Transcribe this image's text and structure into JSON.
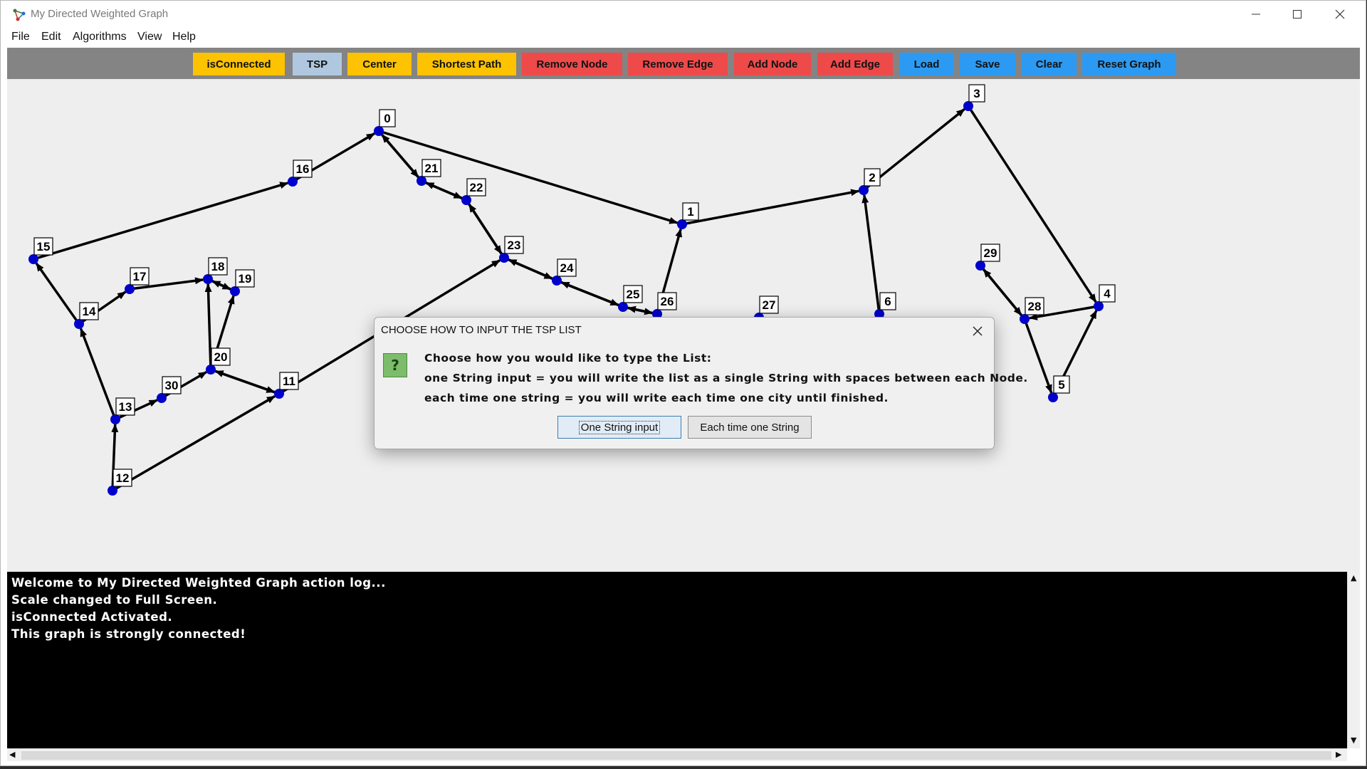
{
  "window": {
    "title": "My Directed Weighted Graph"
  },
  "menu": [
    "File",
    "Edit",
    "Algorithms",
    "View",
    "Help"
  ],
  "toolbar": {
    "buttons": [
      {
        "label": "isConnected",
        "color": "#fdc200"
      },
      {
        "label": "TSP",
        "color": "#afc8df"
      },
      {
        "label": "Center",
        "color": "#fdc200"
      },
      {
        "label": "Shortest Path",
        "color": "#fdc200"
      },
      {
        "label": "Remove Node",
        "color": "#ee4a4a"
      },
      {
        "label": "Remove Edge",
        "color": "#ee4a4a"
      },
      {
        "label": "Add Node",
        "color": "#ee4a4a"
      },
      {
        "label": "Add Edge",
        "color": "#ee4a4a"
      },
      {
        "label": "Load",
        "color": "#2c9af2"
      },
      {
        "label": "Save",
        "color": "#2c9af2"
      },
      {
        "label": "Clear",
        "color": "#2c9af2"
      },
      {
        "label": "Reset Graph",
        "color": "#2c9af2"
      }
    ]
  },
  "graph": {
    "node_color": "#0000cc",
    "edge_color": "#000000",
    "nodes": [
      "0",
      "1",
      "2",
      "3",
      "4",
      "5",
      "6",
      "11",
      "12",
      "13",
      "14",
      "15",
      "16",
      "17",
      "18",
      "19",
      "20",
      "21",
      "22",
      "23",
      "24",
      "25",
      "26",
      "27",
      "28",
      "29",
      "30"
    ],
    "edges": [
      [
        "15",
        "16"
      ],
      [
        "16",
        "0"
      ],
      [
        "0",
        "21"
      ],
      [
        "21",
        "0"
      ],
      [
        "22",
        "21"
      ],
      [
        "21",
        "22"
      ],
      [
        "23",
        "22"
      ],
      [
        "22",
        "23"
      ],
      [
        "23",
        "24"
      ],
      [
        "24",
        "23"
      ],
      [
        "24",
        "25"
      ],
      [
        "25",
        "24"
      ],
      [
        "25",
        "26"
      ],
      [
        "26",
        "25"
      ],
      [
        "26",
        "1"
      ],
      [
        "0",
        "1"
      ],
      [
        "1",
        "2"
      ],
      [
        "6",
        "2"
      ],
      [
        "2",
        "3"
      ],
      [
        "3",
        "4"
      ],
      [
        "5",
        "4"
      ],
      [
        "4",
        "28"
      ],
      [
        "28",
        "5"
      ],
      [
        "28",
        "29"
      ],
      [
        "29",
        "28"
      ],
      [
        "14",
        "15"
      ],
      [
        "14",
        "17"
      ],
      [
        "17",
        "18"
      ],
      [
        "18",
        "19"
      ],
      [
        "19",
        "18"
      ],
      [
        "20",
        "18"
      ],
      [
        "20",
        "19"
      ],
      [
        "13",
        "14"
      ],
      [
        "13",
        "30"
      ],
      [
        "30",
        "20"
      ],
      [
        "20",
        "11"
      ],
      [
        "11",
        "20"
      ],
      [
        "12",
        "13"
      ],
      [
        "12",
        "11"
      ],
      [
        "11",
        "23"
      ]
    ]
  },
  "log": {
    "lines": [
      "Welcome to My Directed Weighted Graph action log...",
      "Scale changed to Full Screen.",
      "isConnected Activated.",
      "This graph is strongly connected!"
    ]
  },
  "dialog": {
    "title": "CHOOSE HOW TO INPUT THE TSP LIST",
    "icon": "question-icon",
    "message": [
      "Choose how you would like to type the List:",
      "one String input = you will write the list as a single String with spaces between each Node.",
      "each time one string = you will write each time one city until finished."
    ],
    "buttons": {
      "one_string": "One String input",
      "each_time": "Each time one String"
    }
  }
}
